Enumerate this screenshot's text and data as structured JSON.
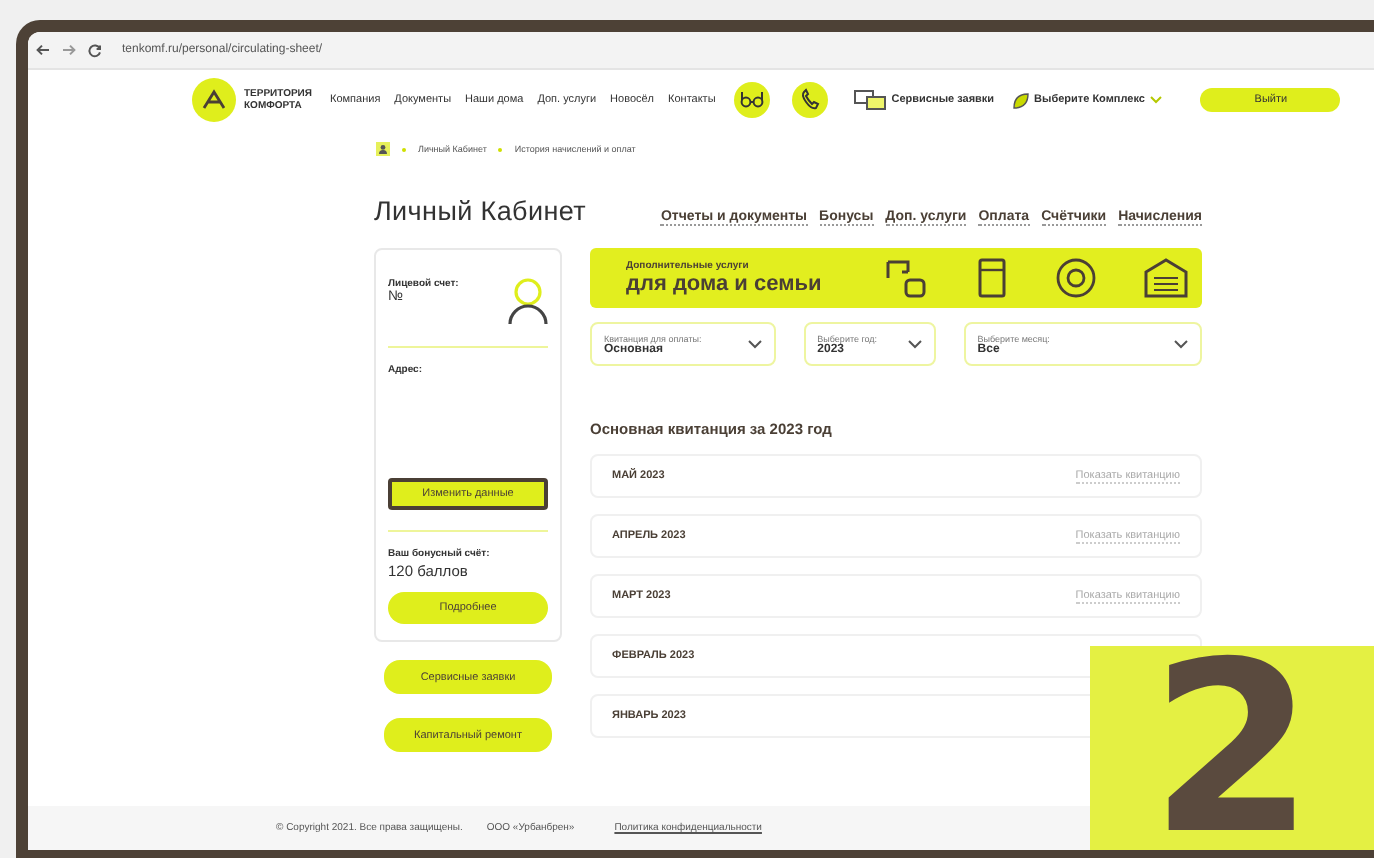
{
  "browser": {
    "url": "tenkomf.ru/personal/circulating-sheet/"
  },
  "header": {
    "logo_lines": [
      "ТЕРРИТОРИЯ",
      "КОМФОРТА"
    ],
    "nav": [
      "Компания",
      "Документы",
      "Наши дома",
      "Доп. услуги",
      "Новосёл",
      "Контакты"
    ],
    "service_requests": "Сервисные заявки",
    "complex_select": "Выберите Комплекс",
    "logout": "Выйти"
  },
  "breadcrumbs": [
    "Личный Кабинет",
    "История начислений и оплат"
  ],
  "page_title": "Личный Кабинет",
  "tabs": [
    "Отчеты и документы",
    "Бонусы",
    "Доп. услуги",
    "Оплата",
    "Счётчики",
    "Начисления"
  ],
  "account": {
    "account_label": "Лицевой счет:",
    "account_number": "№",
    "address_label": "Адрес:",
    "edit_button": "Изменить данные",
    "edit_focused": true,
    "bonus_label": "Ваш бонусный счёт:",
    "bonus_value": "120 баллов",
    "details_button": "Подробнее"
  },
  "side_buttons": [
    "Сервисные заявки",
    "Капитальный ремонт"
  ],
  "banner": {
    "subtitle": "Дополнительные услуги",
    "title": "для дома и семьи"
  },
  "filters": [
    {
      "label": "Квитанция для оплаты:",
      "value": "Основная"
    },
    {
      "label": "Выберите год:",
      "value": "2023"
    },
    {
      "label": "Выберите месяц:",
      "value": "Все"
    }
  ],
  "receipts_title": "Основная квитанция за 2023 год",
  "receipts": [
    {
      "month": "МАЙ 2023",
      "link": "Показать квитанцию"
    },
    {
      "month": "АПРЕЛЬ 2023",
      "link": "Показать квитанцию"
    },
    {
      "month": "МАРТ 2023",
      "link": "Показать квитанцию"
    },
    {
      "month": "ФЕВРАЛЬ 2023"
    },
    {
      "month": "ЯНВАРЬ 2023"
    }
  ],
  "footer": {
    "copyright": "© Copyright 2021. Все права защищены.",
    "company": "ООО «Урбанбрен»",
    "privacy": "Политика конфиденциальности"
  },
  "step_badge": "2"
}
